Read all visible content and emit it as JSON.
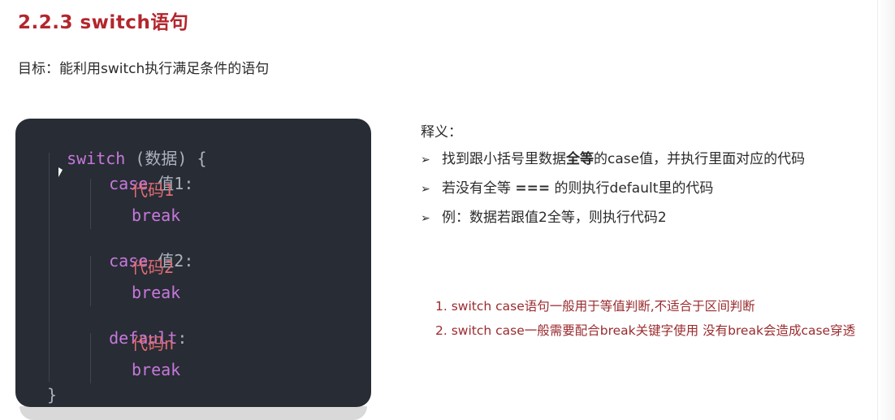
{
  "header": {
    "title": "2.2.3  switch语句",
    "goal": "目标：能利用switch执行满足条件的语句"
  },
  "code": {
    "l1_kw": "switch",
    "l1_rest": " (数据) {",
    "l2_kw": "case",
    "l2_rest": " 值1:",
    "l3": "代码1",
    "l4": "break",
    "l5_kw": "case",
    "l5_rest": " 值2:",
    "l6": "代码2",
    "l7": "break",
    "l8_kw": "default",
    "l8_rest": ":",
    "l9": "代码n",
    "l10": "break",
    "l11": "}"
  },
  "explanation": {
    "title": "释义：",
    "b1_a": "找到跟小括号里数据",
    "b1_bold": "全等",
    "b1_b": "的case值，并执行里面对应的代码",
    "b2_a": "若没有全等 ",
    "b2_op": "===",
    "b2_b": " 的则执行default里的代码",
    "b3": "例：数据若跟值2全等，则执行代码2"
  },
  "notes": {
    "n1": "1. switch case语句一般用于等值判断,不适合于区间判断",
    "n2": "2. switch case一般需要配合break关键字使用 没有break会造成case穿透"
  }
}
